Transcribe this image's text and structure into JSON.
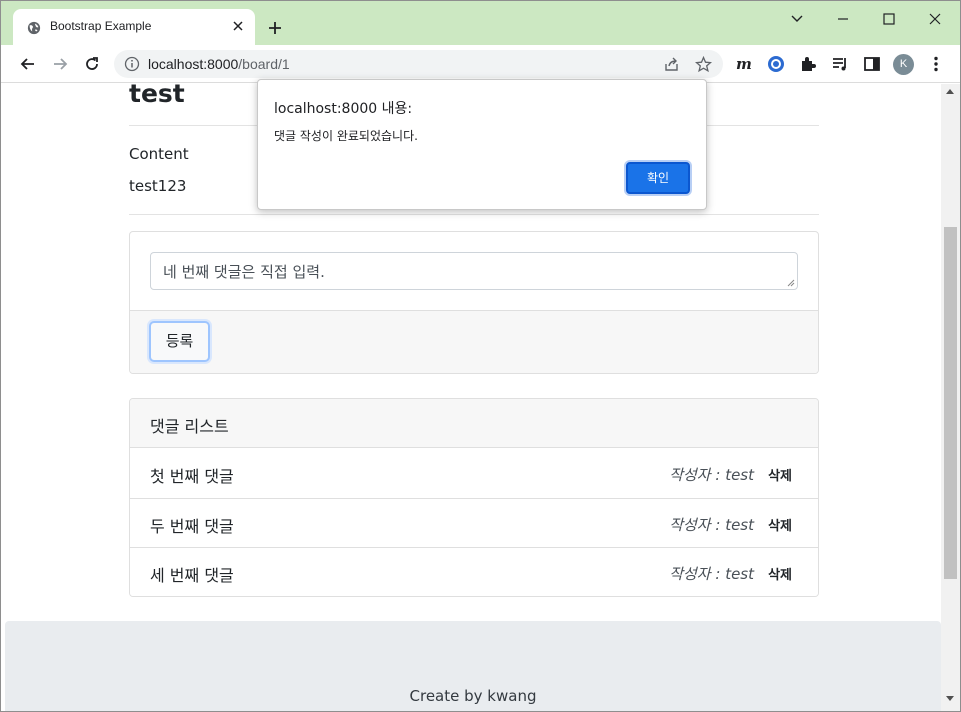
{
  "browser": {
    "tab_title": "Bootstrap Example",
    "url_host": "localhost:8000",
    "url_path": "/board/1",
    "profile_initial": "K"
  },
  "page": {
    "post_title": "test",
    "content_label": "Content",
    "content_body": "test123",
    "comment_input": {
      "value": "네 번째 댓글은 직접 입력."
    },
    "submit_label": "등록",
    "comment_list_header": "댓글 리스트",
    "comments": [
      {
        "text": "첫 번째 댓글",
        "author": "작성자 : test",
        "delete_label": "삭제"
      },
      {
        "text": "두 번째 댓글",
        "author": "작성자 : test",
        "delete_label": "삭제"
      },
      {
        "text": "세 번째 댓글",
        "author": "작성자 : test",
        "delete_label": "삭제"
      }
    ],
    "footer_text": "Create by kwang"
  },
  "dialog": {
    "title": "localhost:8000 내용:",
    "message": "댓글 작성이 완료되었습니다.",
    "ok_label": "확인"
  },
  "colors": {
    "tabstrip": "#cce8c2",
    "dialog_button": "#1a73e8",
    "footer_bg": "#e9ecef"
  }
}
